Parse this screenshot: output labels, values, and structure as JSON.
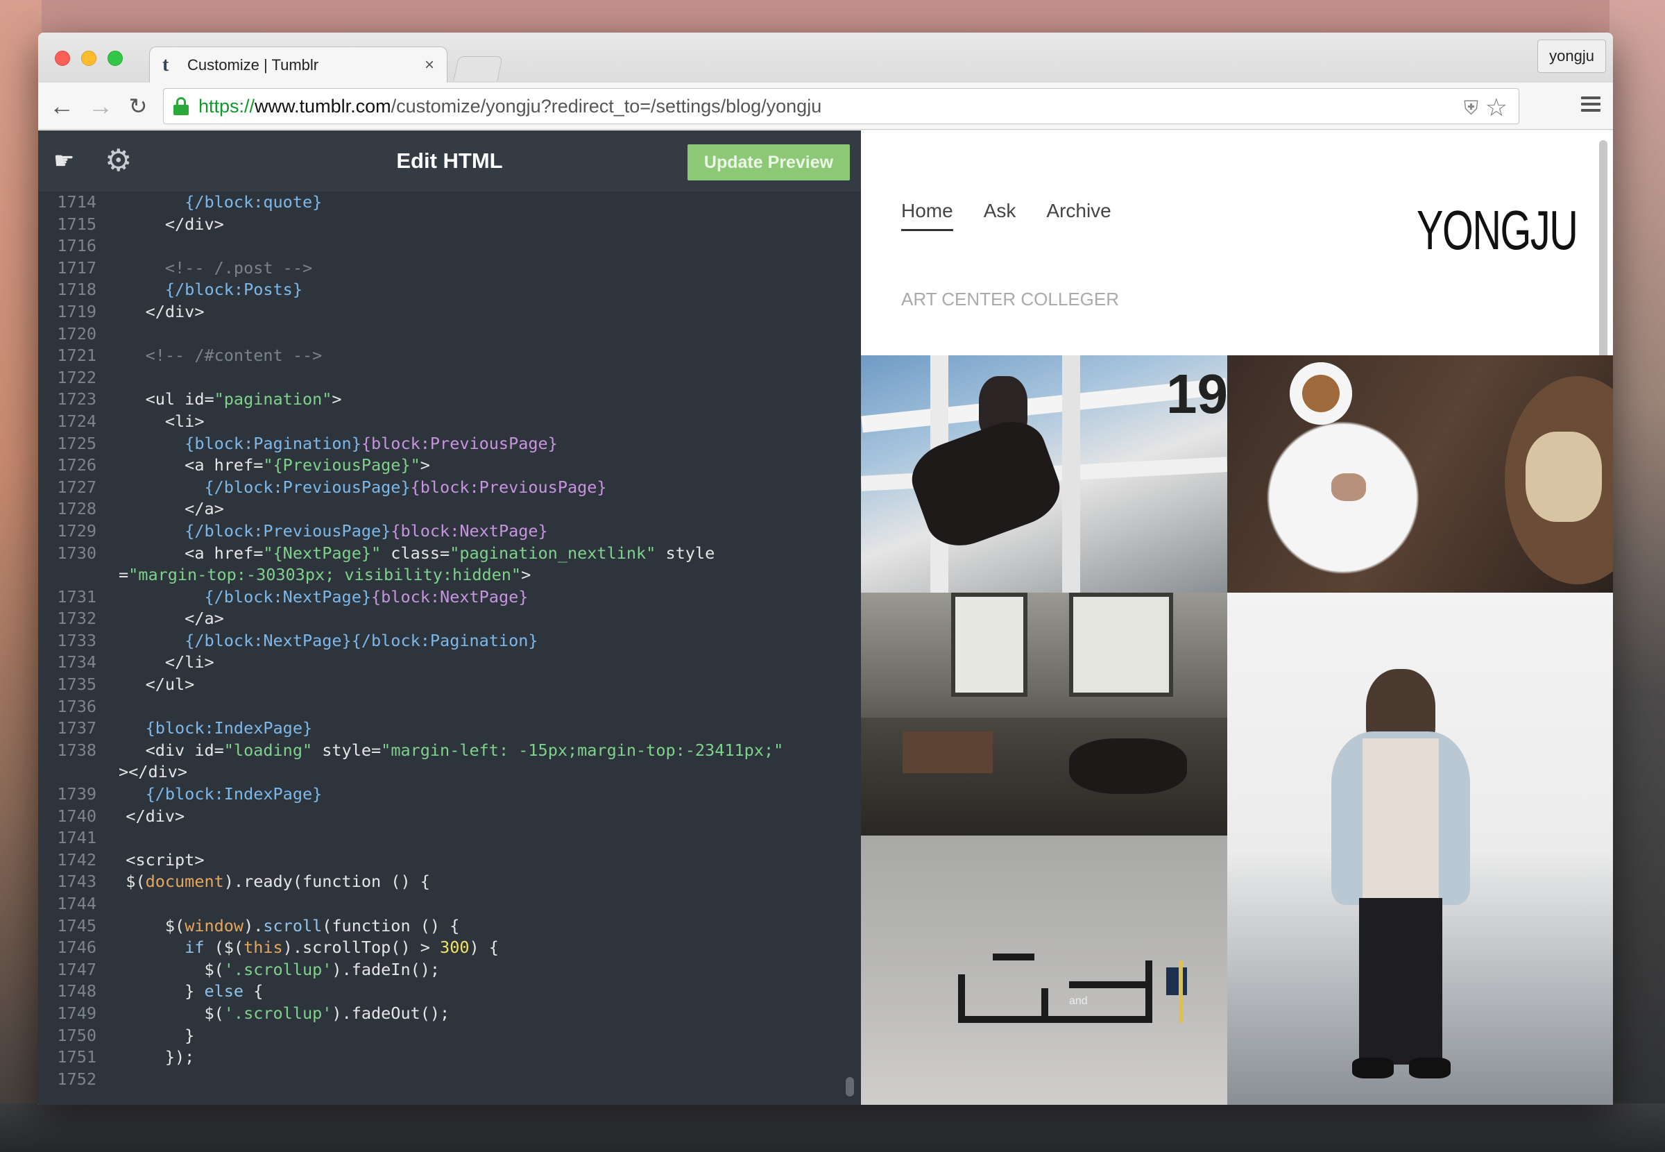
{
  "browser": {
    "tab_title": "Customize | Tumblr",
    "tab_close": "×",
    "profile_name": "yongju",
    "url_scheme": "https://",
    "url_host": "www.tumblr.com",
    "url_path": "/customize/yongju?redirect_to=/settings/blog/yongju",
    "icons": [
      "back-arrow-icon",
      "forward-arrow-icon",
      "reload-icon",
      "lock-icon",
      "shield-icon",
      "star-icon",
      "hamburger-menu-icon"
    ]
  },
  "editor": {
    "title": "Edit HTML",
    "update_button": "Update Preview",
    "code": [
      {
        "n": "1714",
        "t": [
          [
            "",
            "        "
          ],
          [
            "blk",
            "{/block:quote}"
          ]
        ]
      },
      {
        "n": "1715",
        "t": [
          [
            "",
            "      </div>"
          ]
        ]
      },
      {
        "n": "1716",
        "t": [
          [
            "",
            ""
          ]
        ]
      },
      {
        "n": "1717",
        "t": [
          [
            "cmt",
            "      <!-- /.post -->"
          ]
        ]
      },
      {
        "n": "1718",
        "t": [
          [
            "",
            "      "
          ],
          [
            "blk",
            "{/block:Posts}"
          ]
        ]
      },
      {
        "n": "1719",
        "t": [
          [
            "",
            "    </div>"
          ]
        ]
      },
      {
        "n": "1720",
        "t": [
          [
            "",
            ""
          ]
        ]
      },
      {
        "n": "1721",
        "t": [
          [
            "cmt",
            "    <!-- /#content -->"
          ]
        ]
      },
      {
        "n": "1722",
        "t": [
          [
            "",
            ""
          ]
        ]
      },
      {
        "n": "1723",
        "t": [
          [
            "",
            "    <ul id="
          ],
          [
            "str",
            "\"pagination\""
          ],
          [
            "",
            ">"
          ]
        ]
      },
      {
        "n": "1724",
        "t": [
          [
            "",
            "      <li>"
          ]
        ]
      },
      {
        "n": "1725",
        "t": [
          [
            "",
            "        "
          ],
          [
            "blk",
            "{block:Pagination}"
          ],
          [
            "blkcl",
            "{block:PreviousPage}"
          ]
        ]
      },
      {
        "n": "1726",
        "t": [
          [
            "",
            "        <a href="
          ],
          [
            "str",
            "\"{PreviousPage}\""
          ],
          [
            "",
            ">"
          ]
        ]
      },
      {
        "n": "1727",
        "t": [
          [
            "",
            "          "
          ],
          [
            "blk",
            "{/block:PreviousPage}"
          ],
          [
            "blkcl",
            "{block:PreviousPage}"
          ]
        ]
      },
      {
        "n": "1728",
        "t": [
          [
            "",
            "        </a>"
          ]
        ]
      },
      {
        "n": "1729",
        "t": [
          [
            "",
            "        "
          ],
          [
            "blk",
            "{/block:PreviousPage}"
          ],
          [
            "blkcl",
            "{block:NextPage}"
          ]
        ]
      },
      {
        "n": "1730",
        "t": [
          [
            "",
            "        <a href="
          ],
          [
            "str",
            "\"{NextPage}\""
          ],
          [
            "",
            " class="
          ],
          [
            "str",
            "\"pagination_nextlink\""
          ],
          [
            "",
            " style"
          ]
        ]
      },
      {
        "n": "",
        "t": [
          [
            "",
            "="
          ],
          [
            "str",
            "\"margin-top:-30303px; visibility:hidden\""
          ],
          [
            "",
            ">"
          ]
        ]
      },
      {
        "n": "1731",
        "t": [
          [
            "",
            "          "
          ],
          [
            "blk",
            "{/block:NextPage}"
          ],
          [
            "blkcl",
            "{block:NextPage}"
          ]
        ]
      },
      {
        "n": "1732",
        "t": [
          [
            "",
            "        </a>"
          ]
        ]
      },
      {
        "n": "1733",
        "t": [
          [
            "",
            "        "
          ],
          [
            "blk",
            "{/block:NextPage}{/block:Pagination}"
          ]
        ]
      },
      {
        "n": "1734",
        "t": [
          [
            "",
            "      </li>"
          ]
        ]
      },
      {
        "n": "1735",
        "t": [
          [
            "",
            "    </ul>"
          ]
        ]
      },
      {
        "n": "1736",
        "t": [
          [
            "",
            ""
          ]
        ]
      },
      {
        "n": "1737",
        "t": [
          [
            "",
            "    "
          ],
          [
            "blk",
            "{block:IndexPage}"
          ]
        ]
      },
      {
        "n": "1738",
        "t": [
          [
            "",
            "    <div id="
          ],
          [
            "str",
            "\"loading\""
          ],
          [
            "",
            " style="
          ],
          [
            "str",
            "\"margin-left: -15px;margin-top:-23411px;\""
          ]
        ]
      },
      {
        "n": "",
        "t": [
          [
            "",
            "></div>"
          ]
        ]
      },
      {
        "n": "1739",
        "t": [
          [
            "",
            "    "
          ],
          [
            "blk",
            "{/block:IndexPage}"
          ]
        ]
      },
      {
        "n": "1740",
        "t": [
          [
            "",
            "  </div>"
          ]
        ]
      },
      {
        "n": "1741",
        "t": [
          [
            "",
            ""
          ]
        ]
      },
      {
        "n": "1742",
        "t": [
          [
            "",
            "  <script>"
          ]
        ]
      },
      {
        "n": "1743",
        "t": [
          [
            "",
            "  $("
          ],
          [
            "kw",
            "document"
          ],
          [
            "",
            ").ready(function () {"
          ]
        ]
      },
      {
        "n": "1744",
        "t": [
          [
            "",
            ""
          ]
        ]
      },
      {
        "n": "1745",
        "t": [
          [
            "",
            "      $("
          ],
          [
            "kw",
            "window"
          ],
          [
            "",
            ")."
          ],
          [
            "fn",
            "scroll"
          ],
          [
            "",
            "(function () {"
          ]
        ]
      },
      {
        "n": "1746",
        "t": [
          [
            "",
            "        "
          ],
          [
            "fn",
            "if"
          ],
          [
            "",
            " ($("
          ],
          [
            "kw",
            "this"
          ],
          [
            "",
            ").scrollTop() > "
          ],
          [
            "num",
            "300"
          ],
          [
            "",
            ") {"
          ]
        ]
      },
      {
        "n": "1747",
        "t": [
          [
            "",
            "          $("
          ],
          [
            "str",
            "'.scrollup'"
          ],
          [
            "",
            ").fadeIn();"
          ]
        ]
      },
      {
        "n": "1748",
        "t": [
          [
            "",
            "        } "
          ],
          [
            "fn",
            "else"
          ],
          [
            "",
            " {"
          ]
        ]
      },
      {
        "n": "1749",
        "t": [
          [
            "",
            "          $("
          ],
          [
            "str",
            "'.scrollup'"
          ],
          [
            "",
            ").fadeOut();"
          ]
        ]
      },
      {
        "n": "1750",
        "t": [
          [
            "",
            "        }"
          ]
        ]
      },
      {
        "n": "1751",
        "t": [
          [
            "",
            "      });"
          ]
        ]
      },
      {
        "n": "1752",
        "t": [
          [
            "",
            ""
          ]
        ]
      }
    ]
  },
  "preview": {
    "nav": [
      "Home",
      "Ask",
      "Archive"
    ],
    "subtitle": "ART CENTER COLLEGER",
    "logo": "YONGJU",
    "photo_overlay": "19",
    "shelf_label": "and"
  },
  "colors": {
    "editor_bg": "#2e343c",
    "update_button": "#8cc876",
    "string": "#7fd28b",
    "block_tag": "#7db8ea",
    "block_tag_alt": "#c894e0",
    "comment": "#7a838d"
  }
}
